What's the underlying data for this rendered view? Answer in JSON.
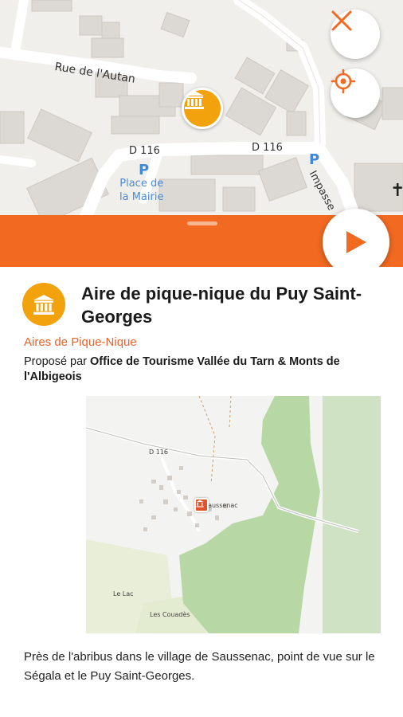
{
  "map": {
    "street_name": "Rue de l'Autan",
    "road_label_1": "D 116",
    "road_label_2": "D 116",
    "impasse_label": "Impasse",
    "parking_label": "P",
    "place_label_line1": "Place de",
    "place_label_line2": "la Mairie",
    "poi_marker_icon": "monument-icon",
    "close_icon": "close-icon",
    "locate_icon": "crosshair-icon",
    "cross_symbol": "✝"
  },
  "colors": {
    "accent_orange": "#f26a21",
    "poi_yellow": "#f2a20d",
    "category_text": "#e8622a"
  },
  "drawer": {
    "play_icon": "play-icon"
  },
  "poi": {
    "title": "Aire de pique-nique du Puy Saint-Georges",
    "category": "Aires de Pique-Nique",
    "provider_prefix": "Proposé par",
    "provider_name": "Office de Tourisme Vallée du Tarn & Monts de l'Albigeois",
    "description": "Près de l'abribus dans le village de Saussenac, point de vue sur le Ségala et le Puy Saint-Georges.",
    "mini_map": {
      "road_label": "D 116",
      "village_label": "Saussenac",
      "place_label_1": "Le Lac",
      "place_label_2": "Les Couadès"
    }
  }
}
